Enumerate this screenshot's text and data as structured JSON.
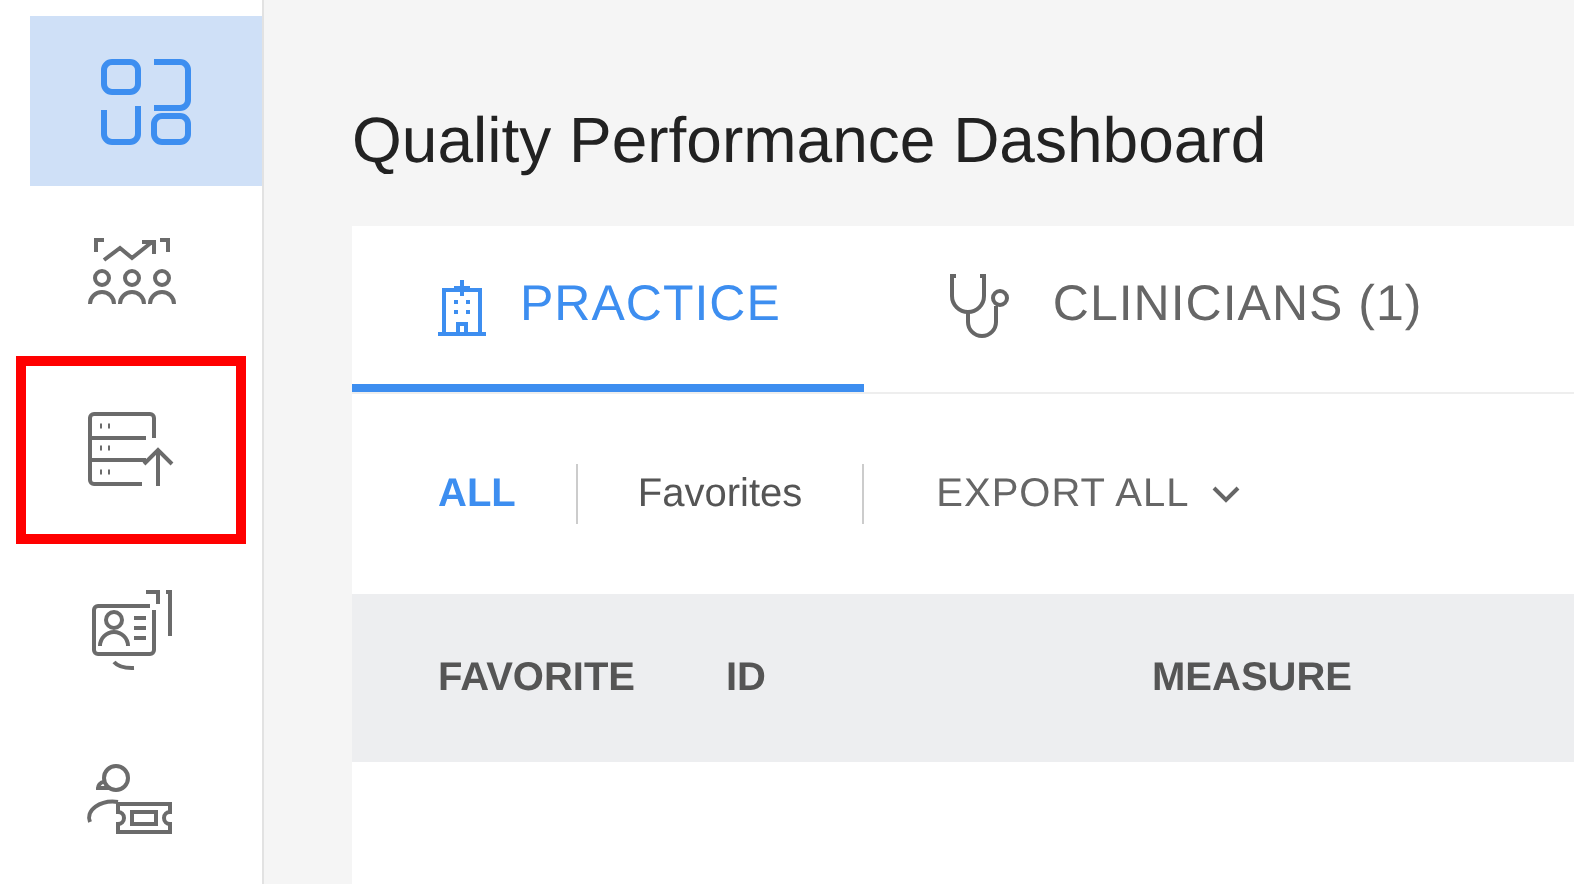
{
  "sidebar": {
    "items": [
      {
        "selected": true,
        "highlighted": false
      },
      {
        "selected": false,
        "highlighted": false
      },
      {
        "selected": false,
        "highlighted": true
      },
      {
        "selected": false,
        "highlighted": false
      },
      {
        "selected": false,
        "highlighted": false
      }
    ]
  },
  "title": "Quality Performance Dashboard",
  "tabs": [
    {
      "label": "PRACTICE",
      "selected": true
    },
    {
      "label": "CLINICIANS (1)",
      "selected": false
    }
  ],
  "filters": [
    {
      "label": "ALL",
      "selected": true
    },
    {
      "label": "Favorites",
      "selected": false
    }
  ],
  "export_button": "EXPORT ALL",
  "table": {
    "columns": [
      "FAVORITE",
      "ID",
      "MEASURE"
    ]
  }
}
